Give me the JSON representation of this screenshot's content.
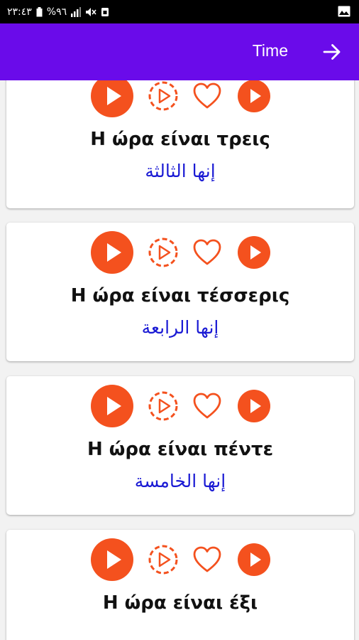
{
  "status_bar": {
    "time": "٢٣:٤٣",
    "battery": "%٩٦"
  },
  "app_bar": {
    "title": "Time"
  },
  "cards": [
    {
      "greek": "Η ώρα είναι τρεις",
      "arabic": "إنها الثالثة"
    },
    {
      "greek": "Η ώρα είναι τέσσερις",
      "arabic": "إنها الرابعة"
    },
    {
      "greek": "Η ώρα είναι πέντε",
      "arabic": "إنها الخامسة"
    },
    {
      "greek": "Η ώρα είναι έξι",
      "arabic": ""
    }
  ],
  "colors": {
    "app_bar": "#6a0bea",
    "accent": "#f4511e",
    "translation_text": "#1a1ad4"
  },
  "icons": [
    "play-icon",
    "slow-play-icon",
    "heart-icon",
    "play-small-icon"
  ]
}
